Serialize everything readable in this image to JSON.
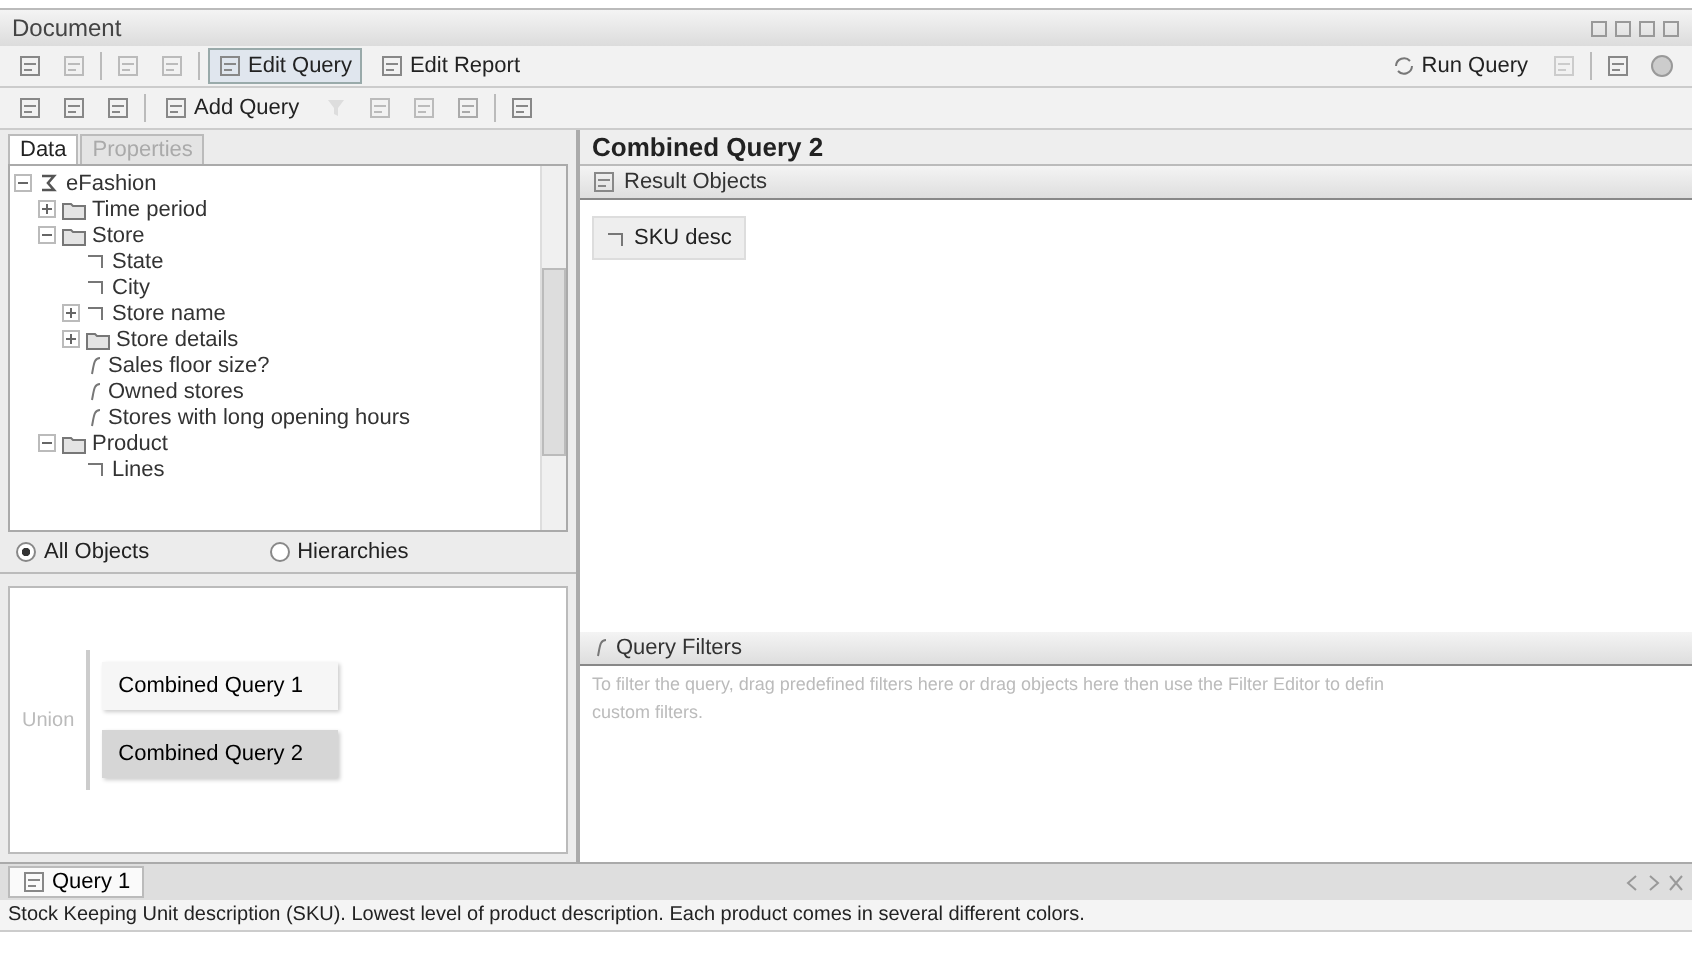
{
  "window": {
    "title": "Document"
  },
  "toolbar": {
    "edit_query": {
      "label": "Edit Query",
      "selected": true
    },
    "edit_report": {
      "label": "Edit Report",
      "selected": false
    },
    "run_query": "Run Query"
  },
  "query_toolbar": {
    "add_query": "Add Query"
  },
  "left_tabs": [
    {
      "label": "Data",
      "selected": true
    },
    {
      "label": "Properties",
      "selected": false
    }
  ],
  "tree": [
    {
      "label": "eFashion",
      "kind": "universe",
      "expanded": true,
      "children": [
        {
          "label": "Time period",
          "kind": "folder",
          "expanded": false
        },
        {
          "label": "Store",
          "kind": "folder",
          "expanded": true,
          "children": [
            {
              "label": "State",
              "kind": "dimension"
            },
            {
              "label": "City",
              "kind": "dimension"
            },
            {
              "label": "Store name",
              "kind": "dimension",
              "expanded": false
            },
            {
              "label": "Store details",
              "kind": "folder",
              "expanded": false
            },
            {
              "label": "Sales floor size?",
              "kind": "filter"
            },
            {
              "label": "Owned stores",
              "kind": "filter"
            },
            {
              "label": "Stores with long opening hours",
              "kind": "filter"
            }
          ]
        },
        {
          "label": "Product",
          "kind": "folder",
          "expanded": true,
          "children": [
            {
              "label": "Lines",
              "kind": "dimension"
            }
          ]
        }
      ]
    }
  ],
  "view_options": [
    {
      "label": "All Objects",
      "selected": true
    },
    {
      "label": "Hierarchies",
      "selected": false
    }
  ],
  "union_label": "Union",
  "queries": [
    {
      "label": "Combined Query 1",
      "selected": false
    },
    {
      "label": "Combined Query 2",
      "selected": true
    }
  ],
  "query_title": "Combined Query 2",
  "result_objects": {
    "title": "Result Objects",
    "items": [
      "SKU desc"
    ]
  },
  "query_filters": {
    "title": "Query Filters",
    "hint_lines": [
      "To filter the query, drag predefined filters here or drag objects here then use the Filter Editor to defin",
      "custom filters."
    ]
  },
  "bottom_tabs": [
    {
      "label": "Query 1",
      "selected": true
    }
  ],
  "status_bar": "Stock Keeping Unit description (SKU). Lowest level of product description. Each product comes in several different colors."
}
